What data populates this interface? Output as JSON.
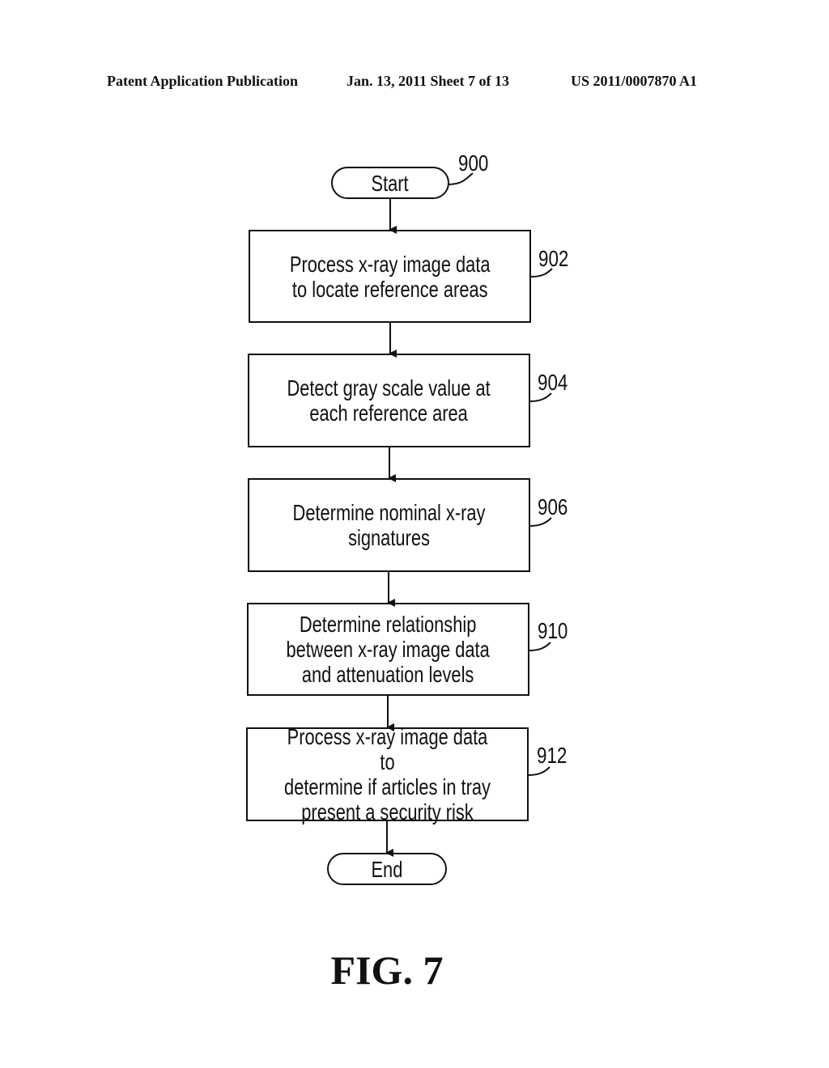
{
  "header": {
    "left": "Patent Application Publication",
    "middle": "Jan. 13, 2011  Sheet 7 of 13",
    "right": "US 2011/0007870 A1"
  },
  "flowchart": {
    "start": {
      "label": "Start",
      "ref": "900"
    },
    "steps": [
      {
        "label": "Process x-ray image data\nto locate reference areas",
        "ref": "902"
      },
      {
        "label": "Detect gray scale value at\neach reference area",
        "ref": "904"
      },
      {
        "label": "Determine nominal x-ray\nsignatures",
        "ref": "906"
      },
      {
        "label": "Determine relationship\nbetween x-ray image data\nand attenuation levels",
        "ref": "910"
      },
      {
        "label": "Process x-ray image data to\ndetermine if articles in tray\npresent a security risk",
        "ref": "912"
      }
    ],
    "end": {
      "label": "End"
    }
  },
  "figure_label": "FIG. 7"
}
